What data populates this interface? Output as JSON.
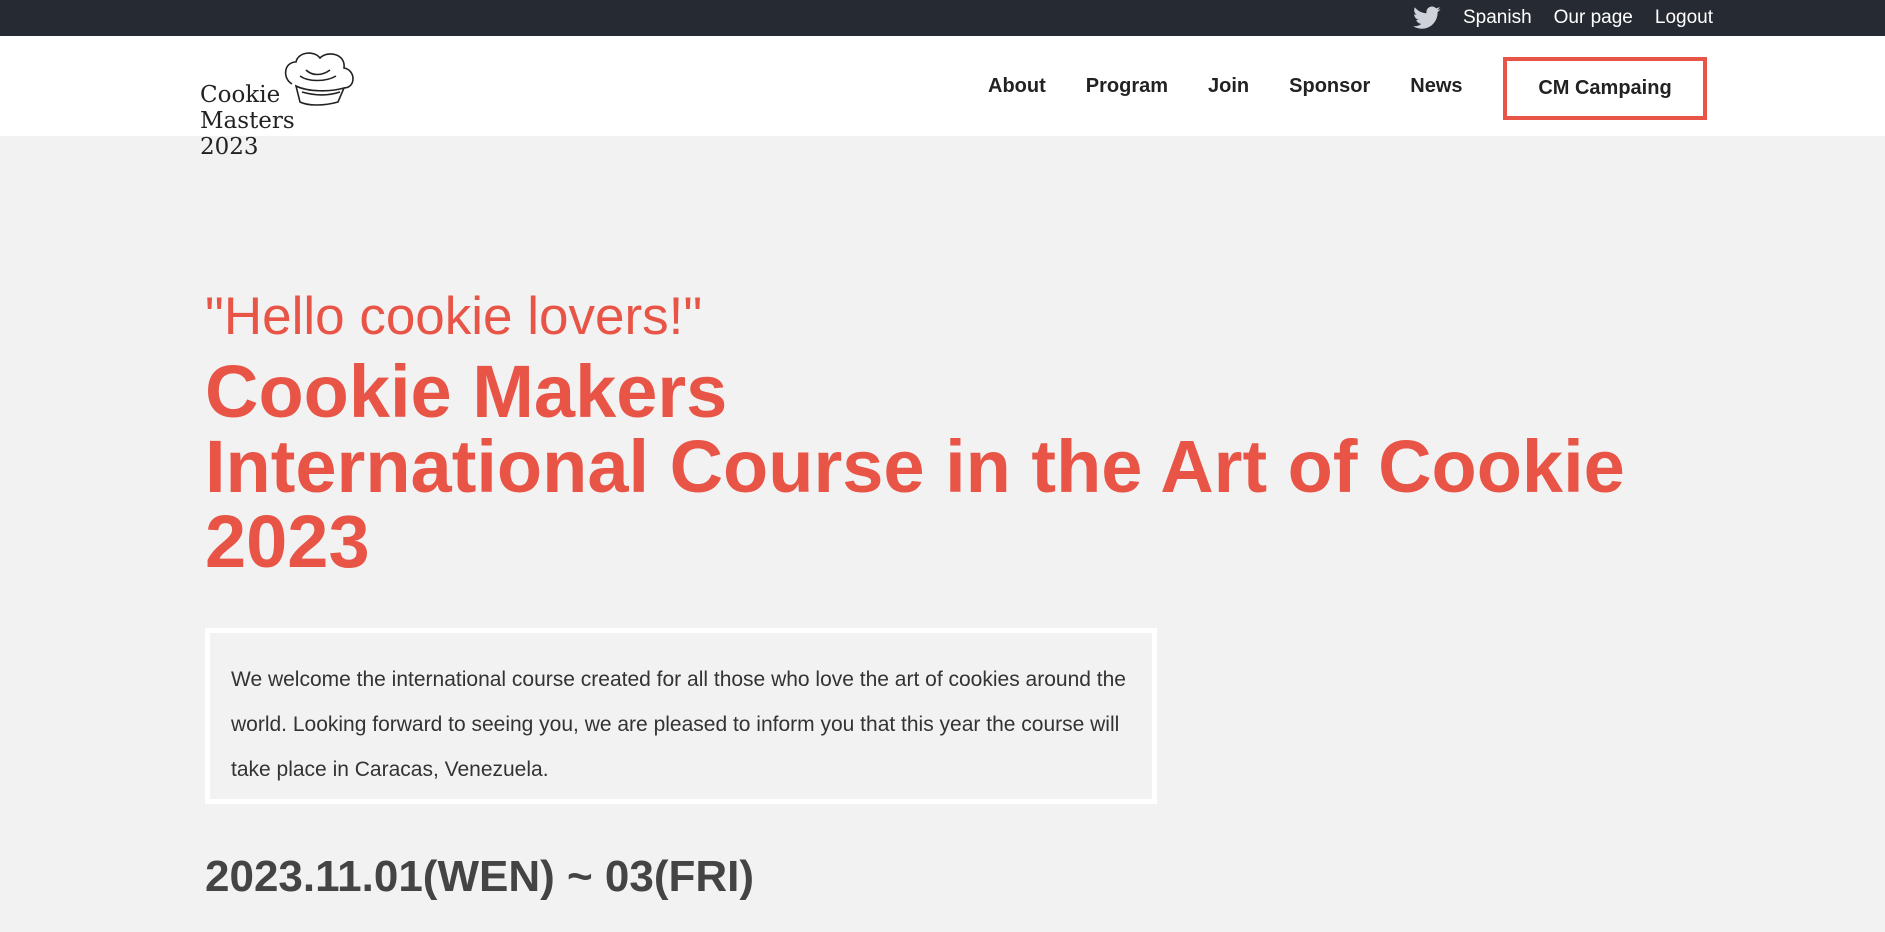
{
  "topbar": {
    "twitter_icon": "twitter-icon",
    "links": [
      "Spanish",
      "Our page",
      "Logout"
    ]
  },
  "header": {
    "logo": {
      "line1": "Cookie",
      "line2": "Masters 2023",
      "icon": "chef-hat-icon"
    },
    "nav": [
      "About",
      "Program",
      "Join",
      "Sponsor",
      "News"
    ],
    "cta_label": "CM Campaing",
    "cta_color": "#e85446"
  },
  "hero": {
    "greeting": "\"Hello cookie lovers!\"",
    "title_line1": "Cookie Makers",
    "title_line2": "International Course in the Art of Cookie",
    "title_line3": "2023",
    "accent_color": "#e85446"
  },
  "welcome": {
    "text": "We welcome the international course created for all those who love the art of cookies around the world. Looking forward to seeing you, we are pleased to inform you that this year the course will take place in Caracas, Venezuela."
  },
  "event": {
    "dates": "2023.11.01(WEN) ~ 03(FRI)"
  }
}
